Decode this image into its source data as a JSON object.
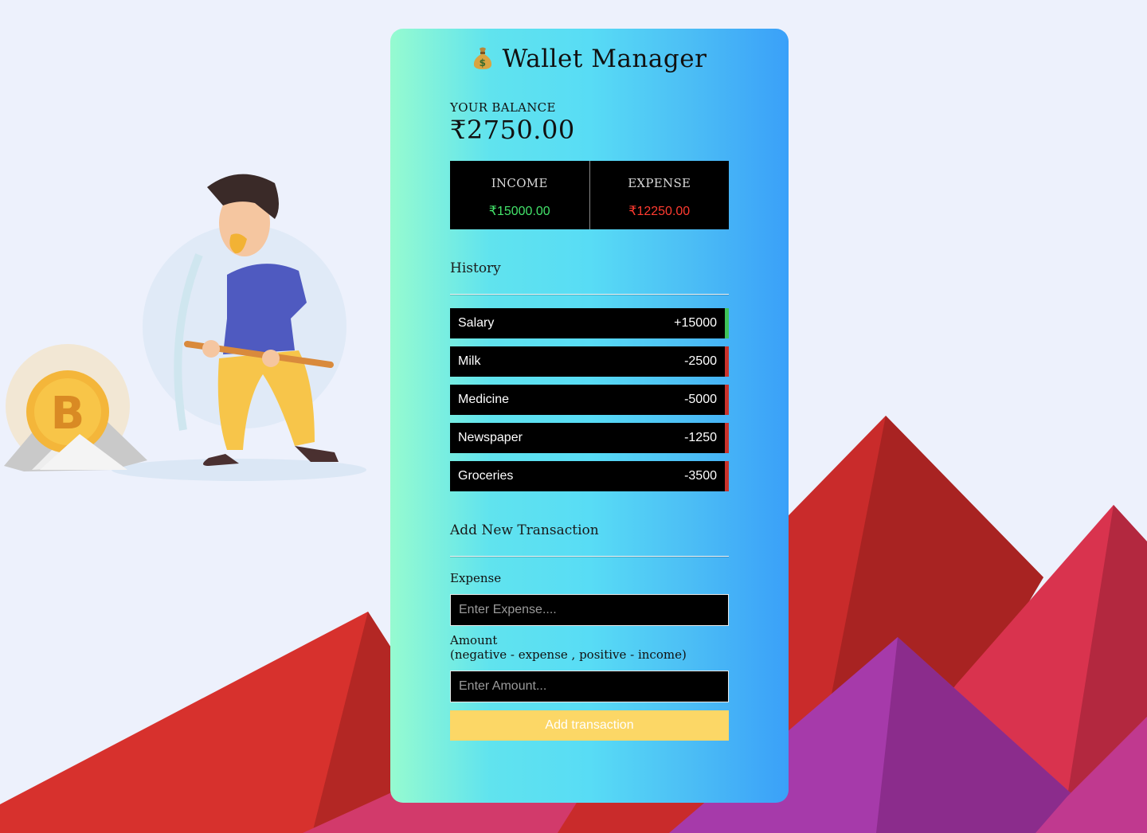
{
  "app": {
    "title": "Wallet Manager",
    "icon": "money-bag-icon"
  },
  "balance": {
    "label": "YOUR BALANCE",
    "value": "₹2750.00"
  },
  "summary": {
    "income_label": "INCOME",
    "income_value": "₹15000.00",
    "expense_label": "EXPENSE",
    "expense_value": "₹12250.00"
  },
  "history": {
    "title": "History",
    "items": [
      {
        "name": "Salary",
        "amount": "+15000",
        "type": "income"
      },
      {
        "name": "Milk",
        "amount": "-2500",
        "type": "expense"
      },
      {
        "name": "Medicine",
        "amount": "-5000",
        "type": "expense"
      },
      {
        "name": "Newspaper",
        "amount": "-1250",
        "type": "expense"
      },
      {
        "name": "Groceries",
        "amount": "-3500",
        "type": "expense"
      }
    ]
  },
  "form": {
    "title": "Add New Transaction",
    "expense_label": "Expense",
    "expense_placeholder": "Enter Expense....",
    "amount_label": "Amount",
    "amount_hint": "(negative - expense , positive - income)",
    "amount_placeholder": "Enter Amount...",
    "submit_label": "Add transaction"
  },
  "colors": {
    "income": "#43e36a",
    "expense": "#ff3b30",
    "income_bar": "#3fc35a",
    "expense_bar": "#c8332c",
    "button": "#fcd766"
  }
}
